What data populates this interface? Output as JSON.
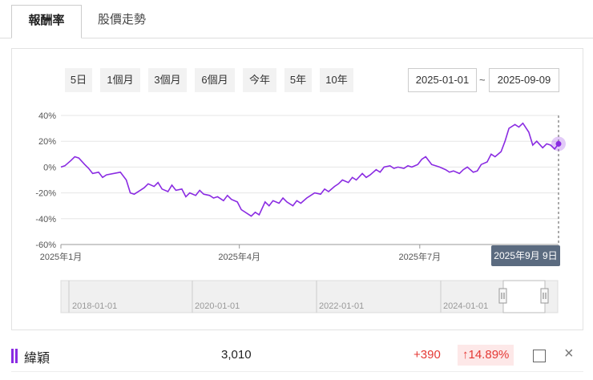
{
  "tabs": [
    {
      "label": "報酬率",
      "active": true
    },
    {
      "label": "股價走勢",
      "active": false
    }
  ],
  "periods": [
    "5日",
    "1個月",
    "3個月",
    "6個月",
    "今年",
    "5年",
    "10年"
  ],
  "date_range": {
    "start": "2025-01-01",
    "separator": "~",
    "end": "2025-09-09"
  },
  "chart_data": {
    "type": "line",
    "y_ticks": [
      "40%",
      "20%",
      "0%",
      "-20%",
      "-40%",
      "-60%"
    ],
    "ylim": [
      -60,
      40
    ],
    "x_ticks": [
      {
        "label": "2025年1月",
        "date": "2025-01-01"
      },
      {
        "label": "2025年4月",
        "date": "2025-04-01"
      },
      {
        "label": "2025年7月",
        "date": "2025-07-01"
      }
    ],
    "xlim": [
      "2025-01-01",
      "2025-09-09"
    ],
    "tooltip_label": "2025年9月 9日",
    "series": [
      {
        "name": "緯穎",
        "color": "#8a2be2",
        "points": [
          [
            "2025-01-01",
            0
          ],
          [
            "2025-01-03",
            1
          ],
          [
            "2025-01-06",
            5
          ],
          [
            "2025-01-08",
            8
          ],
          [
            "2025-01-10",
            7
          ],
          [
            "2025-01-13",
            2
          ],
          [
            "2025-01-15",
            -1
          ],
          [
            "2025-01-17",
            -5
          ],
          [
            "2025-01-20",
            -4
          ],
          [
            "2025-01-22",
            -8
          ],
          [
            "2025-01-24",
            -6
          ],
          [
            "2025-01-31",
            -4
          ],
          [
            "2025-02-03",
            -10
          ],
          [
            "2025-02-05",
            -20
          ],
          [
            "2025-02-07",
            -21
          ],
          [
            "2025-02-10",
            -18
          ],
          [
            "2025-02-12",
            -16
          ],
          [
            "2025-02-14",
            -13
          ],
          [
            "2025-02-17",
            -15
          ],
          [
            "2025-02-19",
            -12
          ],
          [
            "2025-02-21",
            -17
          ],
          [
            "2025-02-24",
            -19
          ],
          [
            "2025-02-26",
            -14
          ],
          [
            "2025-02-28",
            -18
          ],
          [
            "2025-03-03",
            -17
          ],
          [
            "2025-03-05",
            -23
          ],
          [
            "2025-03-07",
            -20
          ],
          [
            "2025-03-10",
            -22
          ],
          [
            "2025-03-12",
            -18
          ],
          [
            "2025-03-14",
            -21
          ],
          [
            "2025-03-17",
            -22
          ],
          [
            "2025-03-19",
            -24
          ],
          [
            "2025-03-21",
            -23
          ],
          [
            "2025-03-24",
            -26
          ],
          [
            "2025-03-26",
            -22
          ],
          [
            "2025-03-28",
            -25
          ],
          [
            "2025-03-31",
            -27
          ],
          [
            "2025-04-02",
            -33
          ],
          [
            "2025-04-07",
            -38
          ],
          [
            "2025-04-09",
            -35
          ],
          [
            "2025-04-11",
            -37
          ],
          [
            "2025-04-14",
            -27
          ],
          [
            "2025-04-16",
            -30
          ],
          [
            "2025-04-18",
            -26
          ],
          [
            "2025-04-21",
            -28
          ],
          [
            "2025-04-23",
            -24
          ],
          [
            "2025-04-25",
            -27
          ],
          [
            "2025-04-28",
            -30
          ],
          [
            "2025-04-30",
            -26
          ],
          [
            "2025-05-02",
            -28
          ],
          [
            "2025-05-05",
            -24
          ],
          [
            "2025-05-07",
            -22
          ],
          [
            "2025-05-09",
            -20
          ],
          [
            "2025-05-12",
            -21
          ],
          [
            "2025-05-14",
            -17
          ],
          [
            "2025-05-16",
            -19
          ],
          [
            "2025-05-19",
            -15
          ],
          [
            "2025-05-21",
            -13
          ],
          [
            "2025-05-23",
            -10
          ],
          [
            "2025-05-26",
            -12
          ],
          [
            "2025-05-28",
            -8
          ],
          [
            "2025-05-30",
            -10
          ],
          [
            "2025-06-02",
            -5
          ],
          [
            "2025-06-04",
            -8
          ],
          [
            "2025-06-06",
            -6
          ],
          [
            "2025-06-09",
            -2
          ],
          [
            "2025-06-11",
            -4
          ],
          [
            "2025-06-13",
            0
          ],
          [
            "2025-06-16",
            1
          ],
          [
            "2025-06-18",
            -1
          ],
          [
            "2025-06-20",
            0
          ],
          [
            "2025-06-23",
            -1
          ],
          [
            "2025-06-25",
            1
          ],
          [
            "2025-06-27",
            0
          ],
          [
            "2025-06-30",
            2
          ],
          [
            "2025-07-02",
            6
          ],
          [
            "2025-07-04",
            8
          ],
          [
            "2025-07-07",
            2
          ],
          [
            "2025-07-09",
            1
          ],
          [
            "2025-07-11",
            0
          ],
          [
            "2025-07-14",
            -2
          ],
          [
            "2025-07-16",
            -4
          ],
          [
            "2025-07-18",
            -3
          ],
          [
            "2025-07-21",
            -5
          ],
          [
            "2025-07-23",
            -2
          ],
          [
            "2025-07-25",
            0
          ],
          [
            "2025-07-28",
            -4
          ],
          [
            "2025-07-30",
            -3
          ],
          [
            "2025-08-01",
            2
          ],
          [
            "2025-08-04",
            4
          ],
          [
            "2025-08-06",
            10
          ],
          [
            "2025-08-08",
            8
          ],
          [
            "2025-08-11",
            12
          ],
          [
            "2025-08-13",
            20
          ],
          [
            "2025-08-15",
            30
          ],
          [
            "2025-08-18",
            33
          ],
          [
            "2025-08-20",
            31
          ],
          [
            "2025-08-22",
            34
          ],
          [
            "2025-08-25",
            27
          ],
          [
            "2025-08-27",
            17
          ],
          [
            "2025-08-29",
            20
          ],
          [
            "2025-09-01",
            15
          ],
          [
            "2025-09-03",
            18
          ],
          [
            "2025-09-05",
            17
          ],
          [
            "2025-09-07",
            14
          ],
          [
            "2025-09-09",
            18
          ]
        ]
      }
    ]
  },
  "navigator": {
    "labels": [
      "2018-01-01",
      "2020-01-01",
      "2022-01-01",
      "2024-01-01"
    ]
  },
  "legend": {
    "name": "緯穎",
    "value": "3,010",
    "change": "+390",
    "change_pct": "↑14.89%",
    "color": "#8a2be2"
  }
}
